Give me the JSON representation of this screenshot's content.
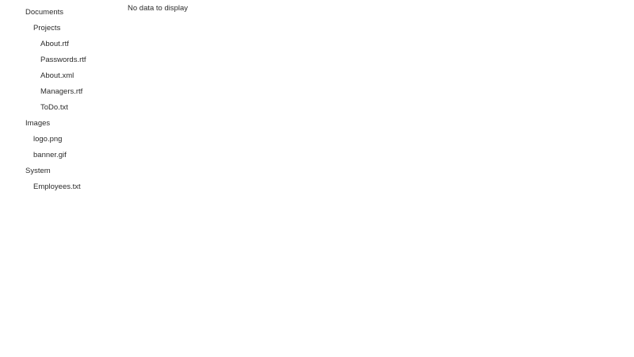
{
  "tree": {
    "items": [
      {
        "label": "Documents",
        "level": 1
      },
      {
        "label": "Projects",
        "level": 2
      },
      {
        "label": "About.rtf",
        "level": 3
      },
      {
        "label": "Passwords.rtf",
        "level": 3
      },
      {
        "label": "About.xml",
        "level": 3
      },
      {
        "label": "Managers.rtf",
        "level": 3
      },
      {
        "label": "ToDo.txt",
        "level": 3
      },
      {
        "label": "Images",
        "level": 1
      },
      {
        "label": "logo.png",
        "level": 2
      },
      {
        "label": "banner.gif",
        "level": 2
      },
      {
        "label": "System",
        "level": 1
      },
      {
        "label": "Employees.txt",
        "level": 2
      }
    ]
  },
  "content": {
    "empty_message": "No data to display"
  }
}
